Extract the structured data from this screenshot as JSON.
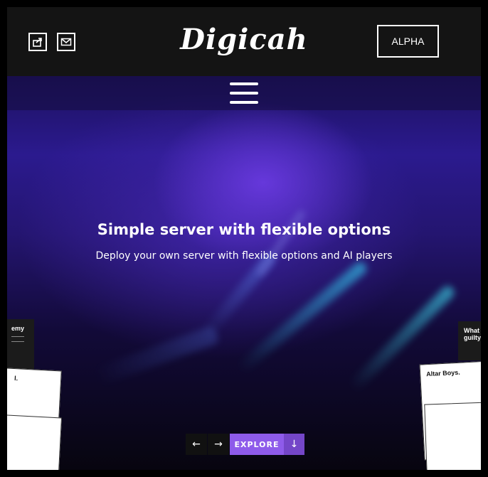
{
  "header": {
    "logo": "Digicah",
    "alpha_label": "ALPHA",
    "share_icon": "share-icon",
    "mail_icon": "mail-icon"
  },
  "menu": {
    "icon": "hamburger-menu-icon"
  },
  "hero": {
    "title": "Simple server with flexible options",
    "subtitle": "Deploy your own server with flexible options and AI players"
  },
  "cards": {
    "left_black": "emy",
    "left_white": "l.",
    "right_black": "What guilty",
    "right_white": "Altar Boys."
  },
  "controls": {
    "prev": "←",
    "next": "→",
    "explore": "EXPLORE",
    "down": "↓"
  },
  "colors": {
    "accent": "#8e5bea",
    "accent_dark": "#7446c8",
    "topbar": "#141414"
  }
}
